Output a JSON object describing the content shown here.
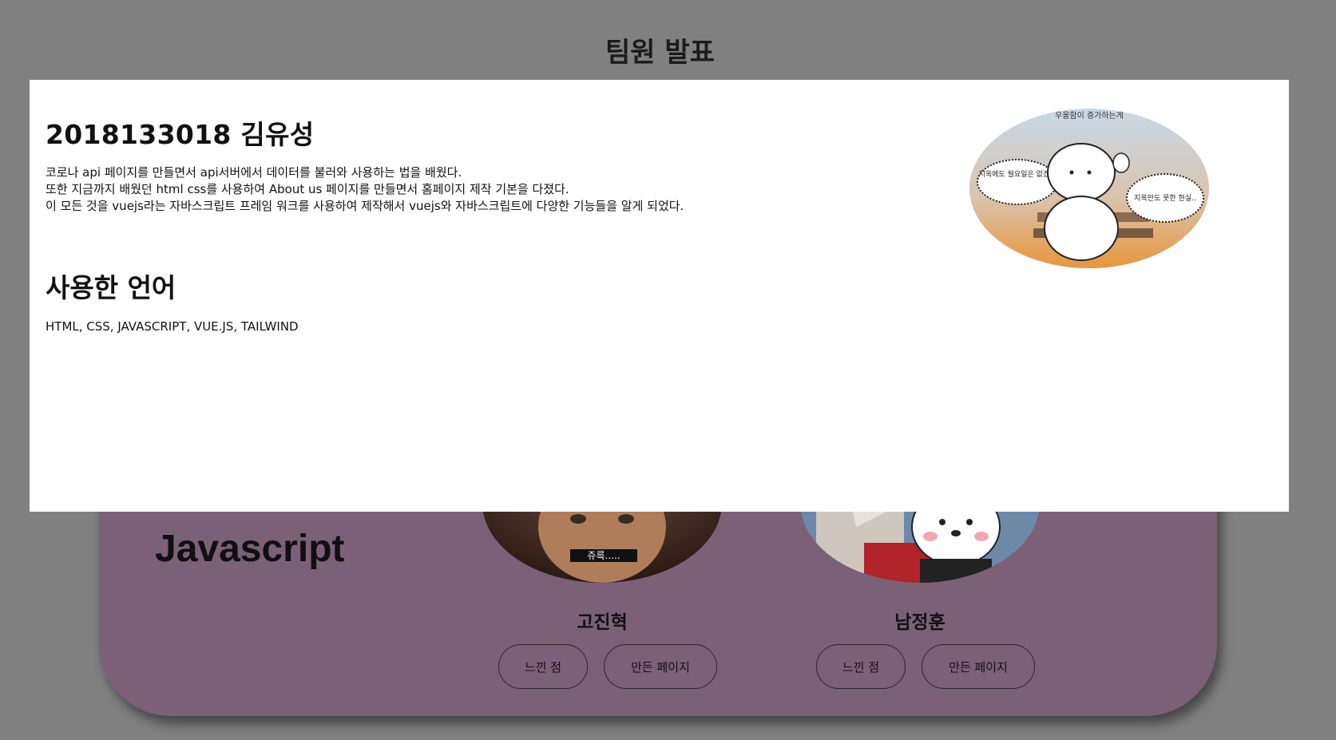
{
  "page": {
    "title": "팀원 발표"
  },
  "background": {
    "language_label": "Javascript",
    "members": [
      {
        "name": "고진혁",
        "feel_button": "느낀 점",
        "page_button": "만든 페이지"
      },
      {
        "name": "남정훈",
        "feel_button": "느낀 점",
        "page_button": "만든 페이지"
      }
    ],
    "photo_captions": {
      "member1_caption": "쥬륵....."
    }
  },
  "modal": {
    "heading": "2018133018 김유성",
    "paragraph_lines": [
      "코로나 api 페이지를 만들면서 api서버에서 데이터를 불러와 사용하는 법을 배웠다.",
      "또한 지금까지 배웠던 html css를 사용하여 About us 페이지를 만들면서 홈페이지 제작 기본을 다졌다.",
      "이 모든 것을 vuejs라는 자바스크립트 프레임 워크를 사용하여 제작해서 vuejs와 자바스크립트에 다양한 기능들을 알게 되었다."
    ],
    "languages_title": "사용한 언어",
    "languages_text": "HTML, CSS, JAVASCRIPT, VUE.JS, TAILWIND",
    "photo": {
      "top_caption": "우울함이 증가하는게",
      "left_bubble": "지옥에도 월요일은 없겠지",
      "right_bubble": "지옥만도 못한 현실.."
    }
  },
  "colors": {
    "overlay": "#808080",
    "card": "#7b6078",
    "modal": "#ffffff"
  }
}
